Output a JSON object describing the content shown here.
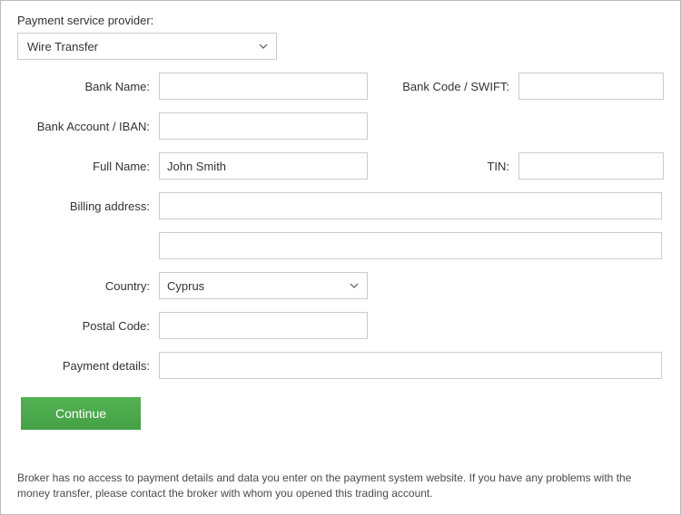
{
  "psp": {
    "label": "Payment service provider:",
    "selected": "Wire Transfer"
  },
  "fields": {
    "bank_name": {
      "label": "Bank Name:",
      "value": ""
    },
    "bank_code": {
      "label": "Bank Code / SWIFT:",
      "value": ""
    },
    "iban": {
      "label": "Bank Account / IBAN:",
      "value": ""
    },
    "full_name": {
      "label": "Full Name:",
      "value": "John Smith"
    },
    "tin": {
      "label": "TIN:",
      "value": ""
    },
    "billing_address": {
      "label": "Billing address:",
      "value1": "",
      "value2": ""
    },
    "country": {
      "label": "Country:",
      "selected": "Cyprus"
    },
    "postal": {
      "label": "Postal Code:",
      "value": ""
    },
    "payment_details": {
      "label": "Payment details:",
      "value": ""
    }
  },
  "button": {
    "continue": "Continue"
  },
  "footnote": "Broker has no access to payment details and data you enter on the payment system website. If you have any problems with the money transfer, please contact the broker with whom you opened this trading account."
}
